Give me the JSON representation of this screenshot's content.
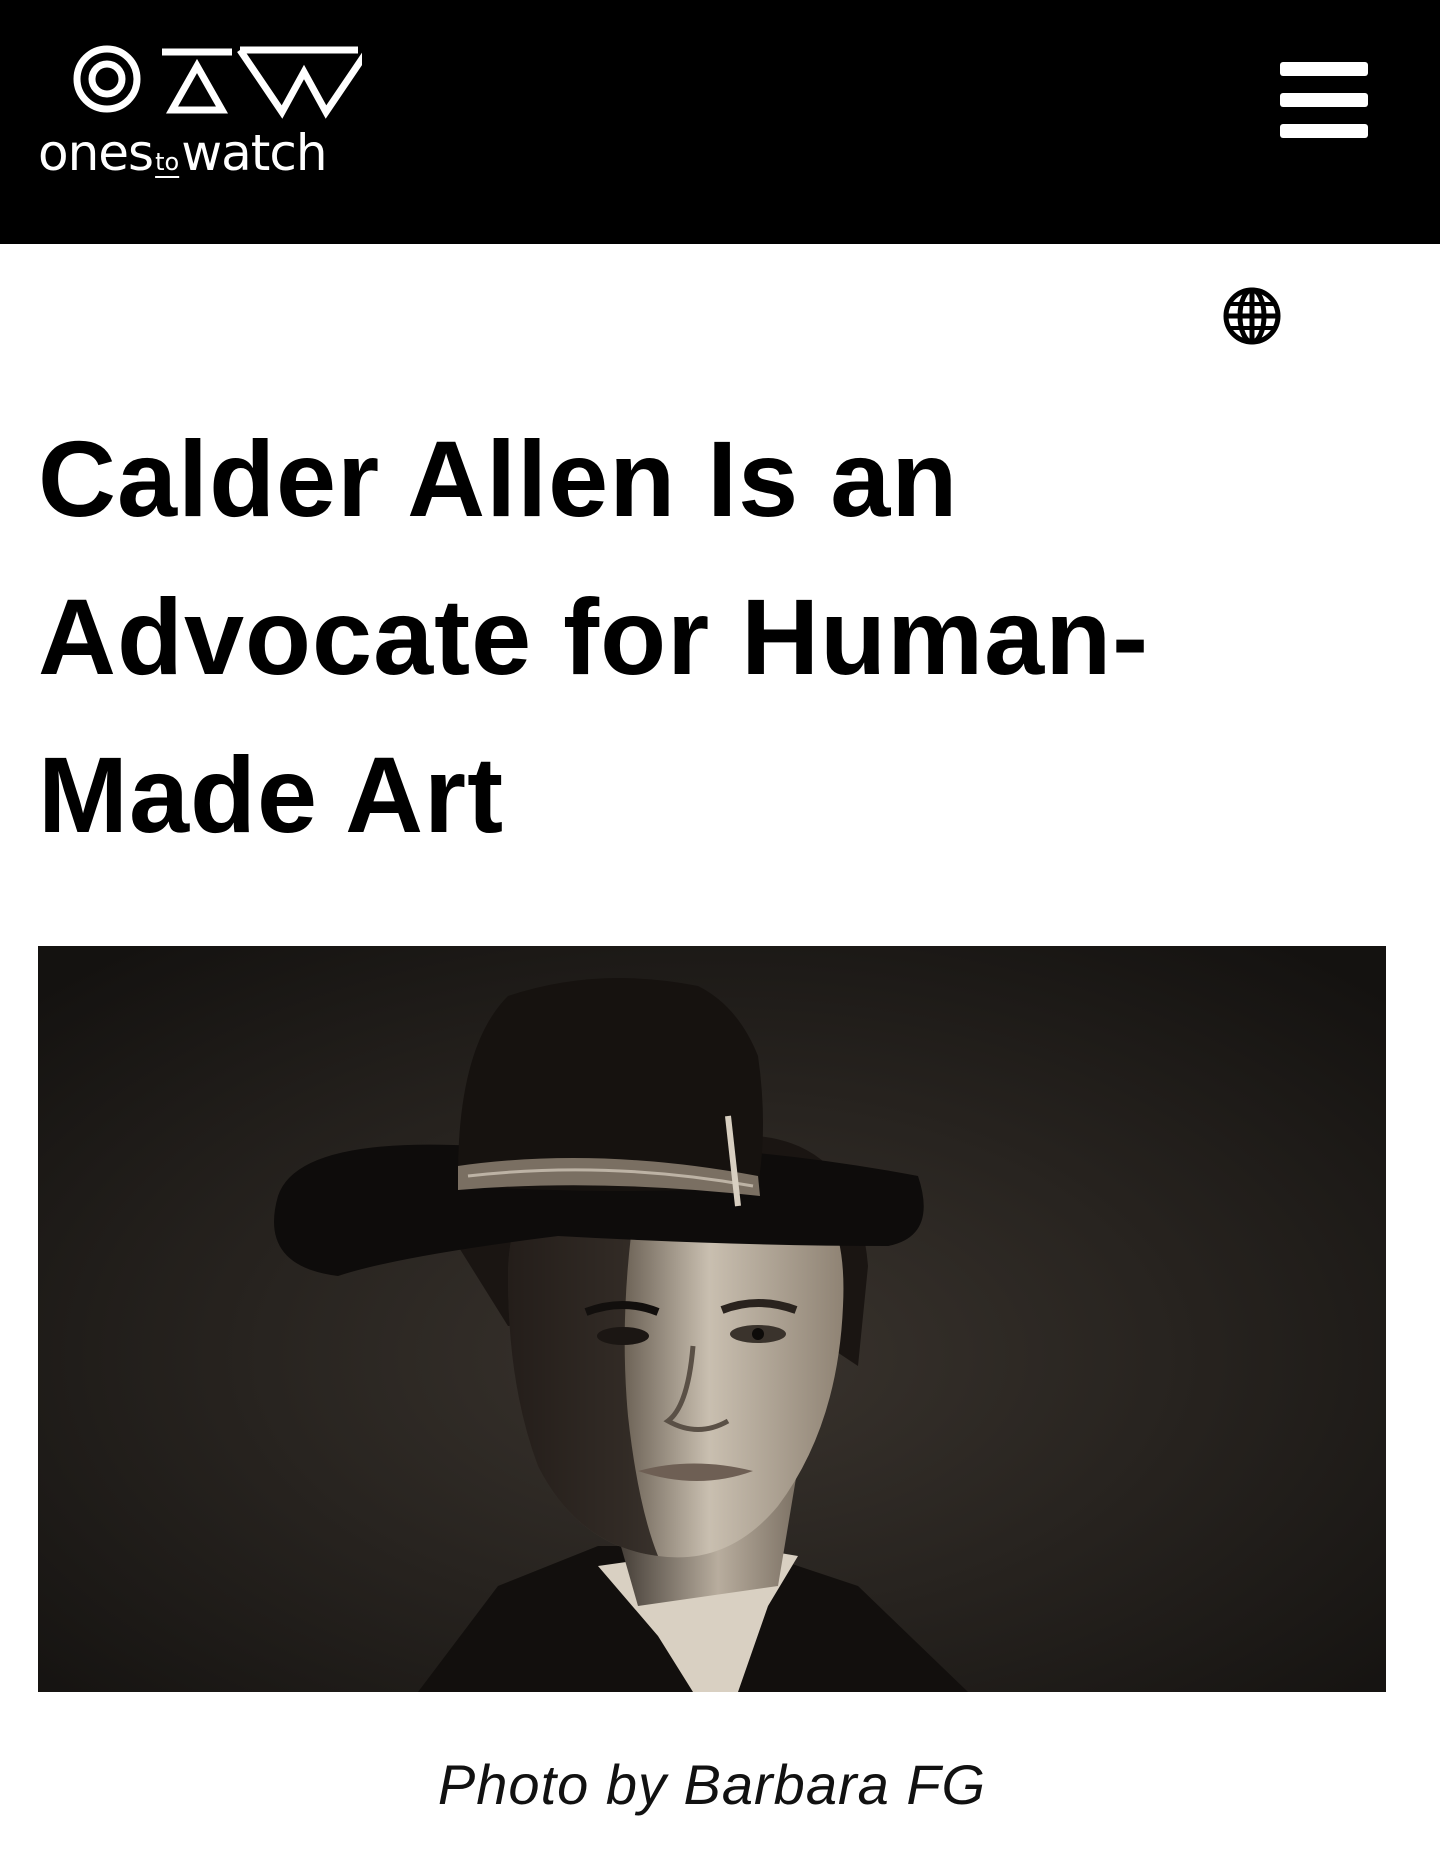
{
  "header": {
    "brand_word_pre": "ones",
    "brand_word_small": "to",
    "brand_word_post": "watch",
    "background": "#000000",
    "foreground": "#ffffff",
    "menu_icon": "hamburger-icon"
  },
  "toolbar": {
    "language_icon": "globe-icon"
  },
  "article": {
    "title_line_1": "Calder Allen Is an",
    "title_line_2": "Advocate for Human-",
    "title_line_3": "Made Art",
    "photo_caption": "Photo by Barbara FG"
  }
}
